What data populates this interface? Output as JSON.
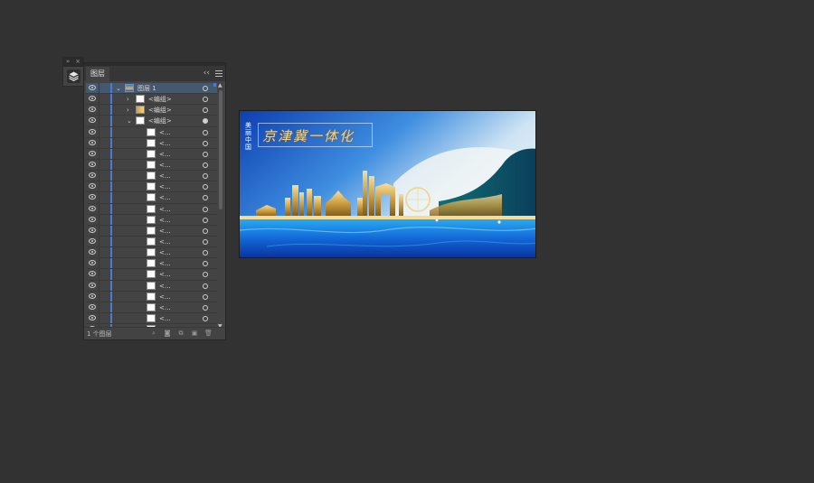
{
  "dock": {
    "collapse_glyph": "»",
    "close_glyph": "×",
    "layers_icon": "layers-stack-icon"
  },
  "panel": {
    "tab_label": "图层",
    "collapse_glyph": "‹‹",
    "menu_icon": "panel-menu-icon",
    "rows": [
      {
        "label": "图层 1",
        "kind": "layer",
        "expand": "⌄",
        "thumb": "img",
        "selected": true,
        "target": "empty"
      },
      {
        "label": "<编组>",
        "kind": "group",
        "expand": "›",
        "thumb": "white",
        "target": "empty"
      },
      {
        "label": "<编组>",
        "kind": "group",
        "expand": "›",
        "thumb": "img2",
        "target": "empty"
      },
      {
        "label": "<编组>",
        "kind": "group",
        "expand": "⌄",
        "thumb": "white",
        "target": "filled"
      },
      {
        "label": "<...",
        "kind": "item",
        "thumb": "white",
        "target": "empty"
      },
      {
        "label": "<...",
        "kind": "item",
        "thumb": "white",
        "target": "empty"
      },
      {
        "label": "<...",
        "kind": "item",
        "thumb": "white",
        "target": "empty"
      },
      {
        "label": "<...",
        "kind": "item",
        "thumb": "white",
        "target": "empty"
      },
      {
        "label": "<...",
        "kind": "item",
        "thumb": "white",
        "target": "empty"
      },
      {
        "label": "<...",
        "kind": "item",
        "thumb": "white",
        "target": "empty"
      },
      {
        "label": "<...",
        "kind": "item",
        "thumb": "white",
        "target": "empty"
      },
      {
        "label": "<...",
        "kind": "item",
        "thumb": "white",
        "target": "empty"
      },
      {
        "label": "<...",
        "kind": "item",
        "thumb": "white",
        "target": "empty"
      },
      {
        "label": "<...",
        "kind": "item",
        "thumb": "white",
        "target": "empty"
      },
      {
        "label": "<...",
        "kind": "item",
        "thumb": "white",
        "target": "empty"
      },
      {
        "label": "<...",
        "kind": "item",
        "thumb": "white",
        "target": "empty"
      },
      {
        "label": "<...",
        "kind": "item",
        "thumb": "white",
        "target": "empty"
      },
      {
        "label": "<...",
        "kind": "item",
        "thumb": "white",
        "target": "empty"
      },
      {
        "label": "<...",
        "kind": "item",
        "thumb": "white",
        "target": "empty"
      },
      {
        "label": "<...",
        "kind": "item",
        "thumb": "white",
        "target": "empty"
      },
      {
        "label": "<...",
        "kind": "item",
        "thumb": "white",
        "target": "empty"
      },
      {
        "label": "<...",
        "kind": "item",
        "thumb": "white",
        "target": "empty"
      },
      {
        "label": "<...",
        "kind": "item",
        "thumb": "white",
        "target": "empty"
      },
      {
        "label": "<...",
        "kind": "item",
        "thumb": "white",
        "target": "empty"
      },
      {
        "label": "<...",
        "kind": "item",
        "thumb": "white",
        "target": "empty"
      },
      {
        "label": "<...",
        "kind": "item",
        "thumb": "white",
        "target": "empty"
      }
    ],
    "footer": {
      "count": "1 个图层",
      "icons": [
        "locate-object-icon",
        "make-clip-mask-icon",
        "new-sublayer-icon",
        "new-layer-icon",
        "delete-icon"
      ]
    }
  },
  "artboard": {
    "brand_text": "美丽中国",
    "title": "京津冀一体化"
  },
  "colors": {
    "app_bg": "#323232",
    "panel_bg": "#434343",
    "selection": "#46586e",
    "layer_color_bar": "#4d79d6",
    "title_gold": "#f2d58b"
  }
}
